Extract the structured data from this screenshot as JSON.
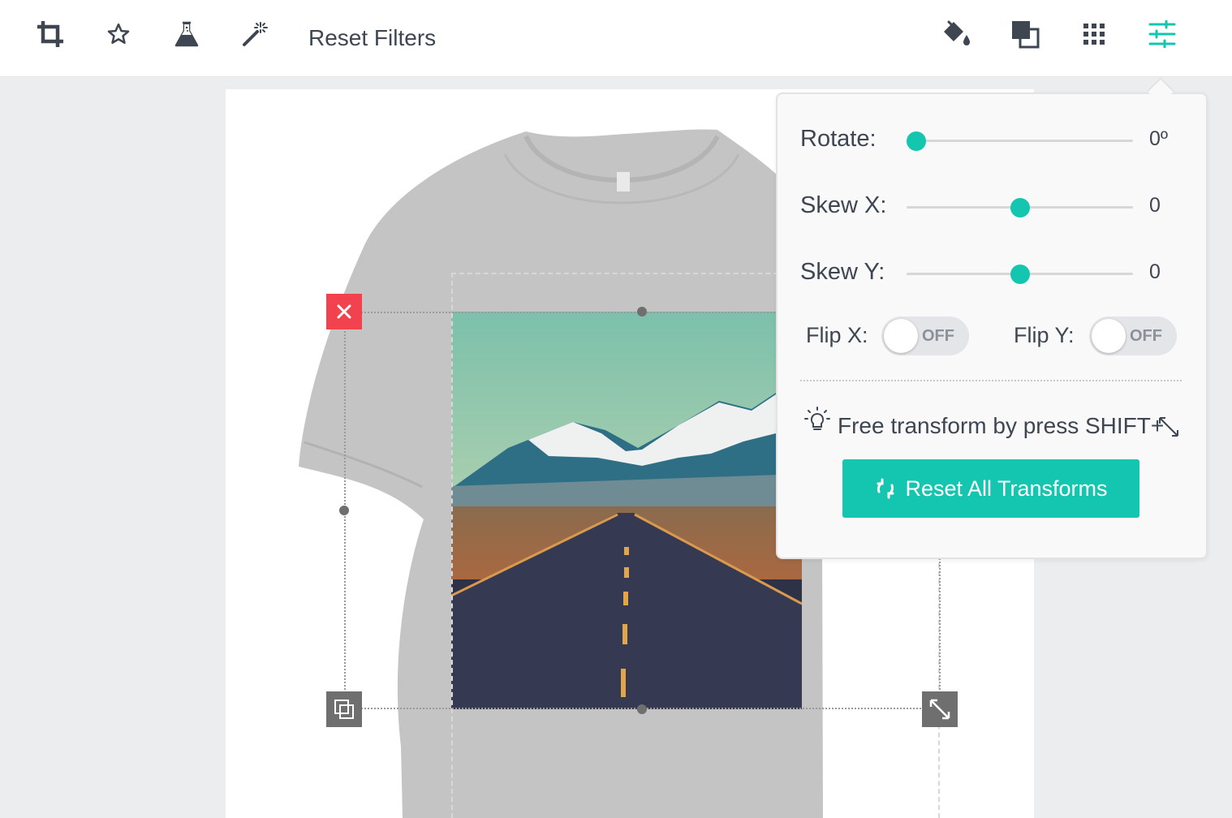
{
  "toolbar": {
    "left_icons": [
      "crop-icon",
      "star-icon",
      "flask-icon",
      "magic-wand-icon"
    ],
    "reset_filters_label": "Reset Filters",
    "right_icons": [
      "paint-bucket-icon",
      "layers-icon",
      "grid-icon",
      "sliders-icon"
    ],
    "active_icon": "sliders-icon"
  },
  "colors": {
    "accent": "#14c5b0",
    "delete": "#f0434f",
    "text": "#3d4651",
    "shirt": "#c4c4c4"
  },
  "transform_panel": {
    "rotate": {
      "label": "Rotate:",
      "value": "0º",
      "level": 0.0
    },
    "skew_x": {
      "label": "Skew X:",
      "value": "0",
      "level": 0.5
    },
    "skew_y": {
      "label": "Skew Y:",
      "value": "0",
      "level": 0.5
    },
    "flip_x": {
      "label": "Flip X:",
      "state": "OFF"
    },
    "flip_y": {
      "label": "Flip Y:",
      "state": "OFF"
    },
    "tip_text": "Free transform by press SHIFT+",
    "tip_icons": [
      "lightbulb-icon",
      "resize-diagonal-icon"
    ],
    "reset_button_label": "Reset All Transforms"
  },
  "canvas": {
    "product": "t-shirt",
    "design_controls": [
      "delete-icon",
      "duplicate-icon",
      "resize-icon"
    ]
  }
}
